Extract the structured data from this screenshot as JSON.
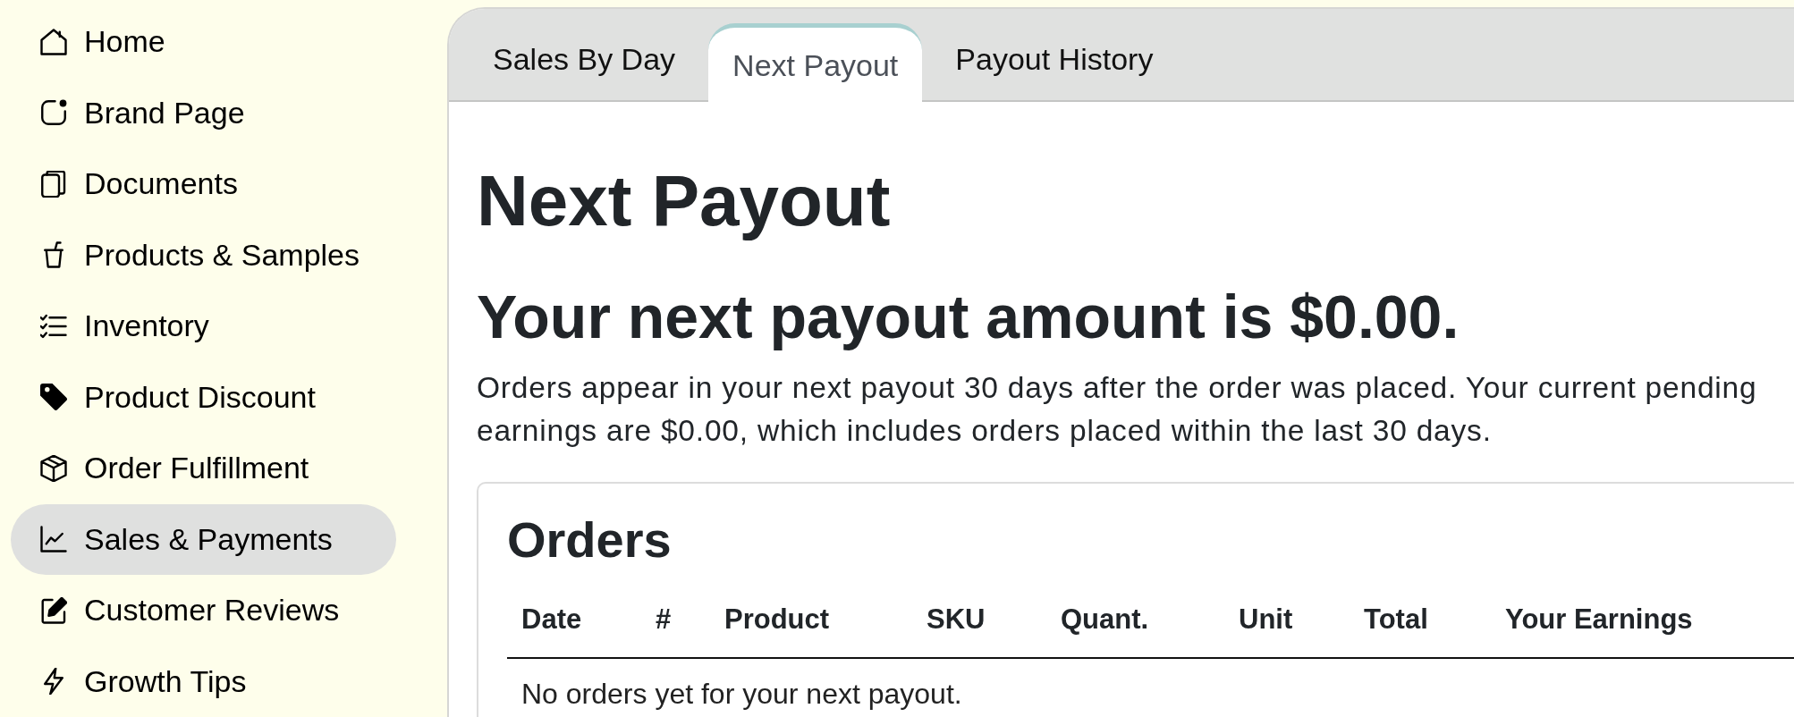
{
  "sidebar": {
    "items": [
      {
        "label": "Home",
        "selected": false
      },
      {
        "label": "Brand Page",
        "selected": false
      },
      {
        "label": "Documents",
        "selected": false
      },
      {
        "label": "Products & Samples",
        "selected": false
      },
      {
        "label": "Inventory",
        "selected": false
      },
      {
        "label": "Product Discount",
        "selected": false
      },
      {
        "label": "Order Fulfillment",
        "selected": false
      },
      {
        "label": "Sales & Payments",
        "selected": true
      },
      {
        "label": "Customer Reviews",
        "selected": false
      },
      {
        "label": "Growth Tips",
        "selected": false
      }
    ]
  },
  "tabs": [
    {
      "label": "Sales By Day",
      "selected": false
    },
    {
      "label": "Next Payout",
      "selected": true
    },
    {
      "label": "Payout History",
      "selected": false
    }
  ],
  "page": {
    "title": "Next Payout",
    "summary": "Your next payout amount is $0.00.",
    "note": "Orders appear in your next payout 30 days after the order was placed. Your current pending earnings are $0.00, which includes orders placed within the last 30 days."
  },
  "orders": {
    "title": "Orders",
    "table": {
      "columns": [
        "Date",
        "#",
        "Product",
        "SKU",
        "Quant.",
        "Unit",
        "Total",
        "Your Earnings"
      ],
      "empty_message": "No orders yet for your next payout."
    }
  }
}
